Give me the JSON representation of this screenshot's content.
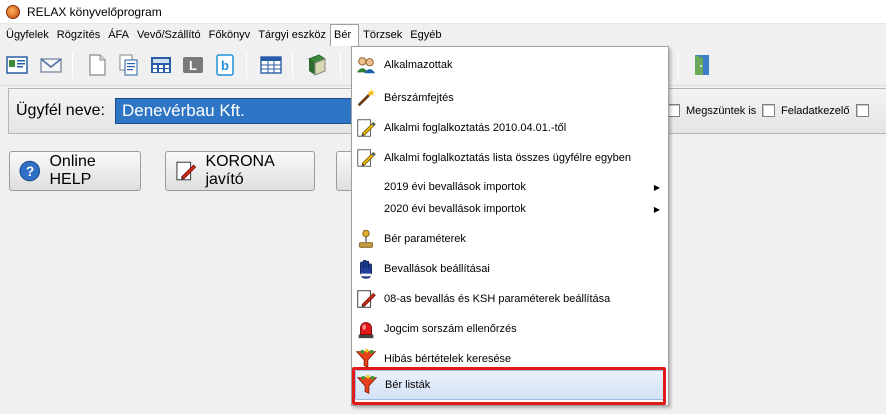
{
  "window": {
    "title": "RELAX könyvelőprogram"
  },
  "menubar": {
    "items": [
      "Ügyfelek",
      "Rögzítés",
      "ÁFA",
      "Vevő/Szállító",
      "Főkönyv",
      "Tárgyi eszköz",
      "Bér",
      "Törzsek",
      "Egyéb"
    ]
  },
  "client": {
    "label": "Ügyfél neve:",
    "value": "Denevérbau Kft.",
    "checkbox_ceased": "Megszüntek is",
    "checkbox_taskmanager": "Feladatkezelő"
  },
  "buttons": {
    "online_help": "Online HELP",
    "korona": "KORONA javító"
  },
  "dropdown": {
    "items": [
      {
        "label": "Alkalmazottak",
        "icon": "employees-icon"
      },
      {
        "label": "Bérszámfejtés",
        "icon": "magic-wand-icon"
      },
      {
        "label": "Alkalmi foglalkoztatás 2010.04.01.-től",
        "icon": "edit-document-icon"
      },
      {
        "label": "Alkalmi foglalkoztatás lista összes ügyfélre egyben",
        "icon": "edit-document-icon"
      },
      {
        "label": "2019 évi bevallások importok",
        "icon": ""
      },
      {
        "label": "2020 évi bevallások importok",
        "icon": ""
      },
      {
        "label": "Bér paraméterek",
        "icon": "joystick-icon"
      },
      {
        "label": "Bevallások beállításai",
        "icon": "hand-icon"
      },
      {
        "label": "08-as bevallás és KSH paraméterek beállítása",
        "icon": "edit-document-icon"
      },
      {
        "label": "Jogcim sorszám ellenőrzés",
        "icon": "alarm-light-icon"
      },
      {
        "label": "Hibás bértételek keresése",
        "icon": "filter-icon"
      },
      {
        "label": "Bér listák",
        "icon": "filter-icon"
      }
    ],
    "selected": "Bér listák"
  },
  "colors": {
    "highlight": "#e01919",
    "client_field_bg": "#2f75c5"
  }
}
